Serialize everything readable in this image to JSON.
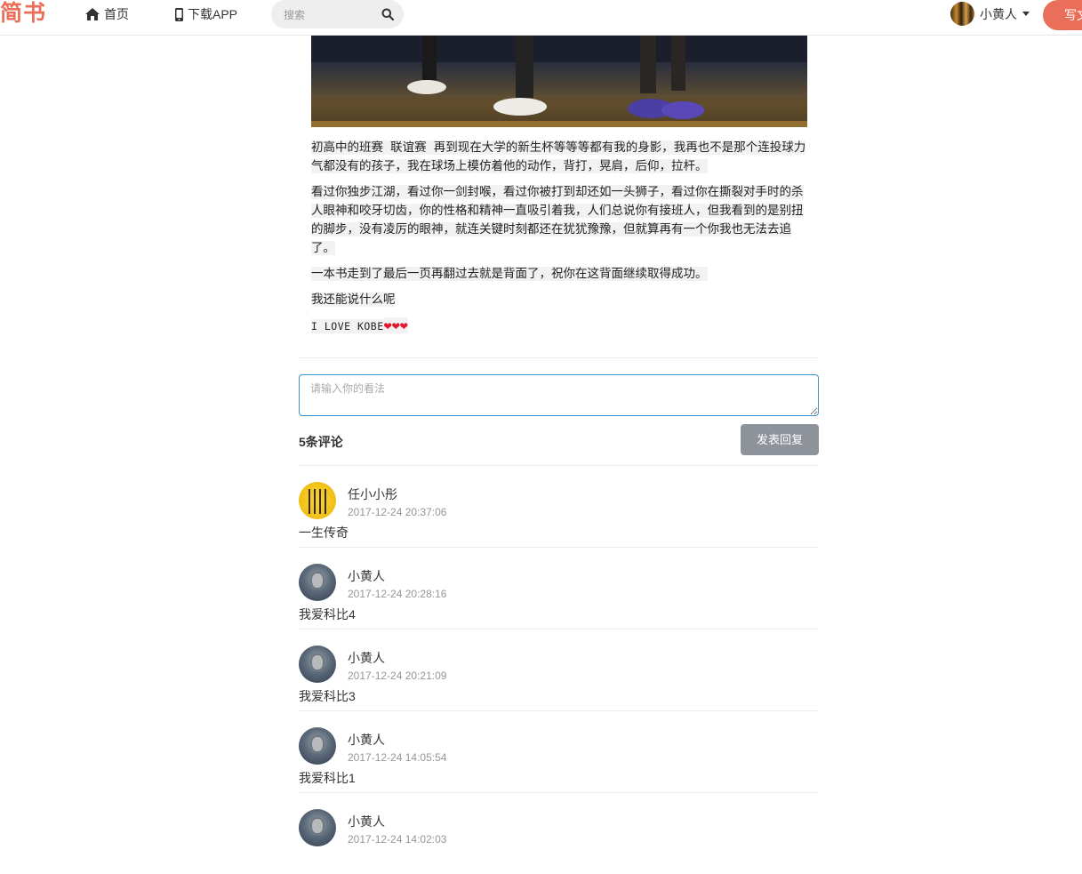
{
  "navbar": {
    "logo": "简书",
    "home_label": "首页",
    "app_label": "下载APP",
    "search_placeholder": "搜索",
    "user_name": "小黄人",
    "write_label": "写文章"
  },
  "article": {
    "paragraphs": [
      "初高中的班赛 联谊赛 再到现在大学的新生杯等等等都有我的身影，我再也不是那个连投球力气都没有的孩子，我在球场上模仿着他的动作，背打，晃肩，后仰，拉杆。",
      "看过你独步江湖，看过你一剑封喉，看过你被打到却还如一头狮子，看过你在撕裂对手时的杀人眼神和咬牙切齿，你的性格和精神一直吸引着我，人们总说你有接班人，但我看到的是别扭的脚步，没有凌厉的眼神，就连关键时刻都还在犹犹豫豫，但就算再有一个你我也无法去追了。",
      "一本书走到了最后一页再翻过去就是背面了，祝你在这背面继续取得成功。",
      "我还能说什么呢"
    ],
    "love_line": "I LOVE KOBE",
    "hearts": "❤❤❤"
  },
  "comment_form": {
    "placeholder": "请输入你的看法",
    "count_label": "5条评论",
    "reply_label": "发表回复"
  },
  "comments": [
    {
      "name": "任小小彤",
      "time": "2017-12-24 20:37:06",
      "text": "一生传奇"
    },
    {
      "name": "小黄人",
      "time": "2017-12-24 20:28:16",
      "text": "我爱科比4"
    },
    {
      "name": "小黄人",
      "time": "2017-12-24 20:21:09",
      "text": "我爱科比3"
    },
    {
      "name": "小黄人",
      "time": "2017-12-24 14:05:54",
      "text": "我爱科比1"
    },
    {
      "name": "小黄人",
      "time": "2017-12-24 14:02:03",
      "text": ""
    }
  ],
  "colors": {
    "brand": "#ea6f5a",
    "reply_button": "#8e939b",
    "input_focus": "#3a95d0"
  }
}
